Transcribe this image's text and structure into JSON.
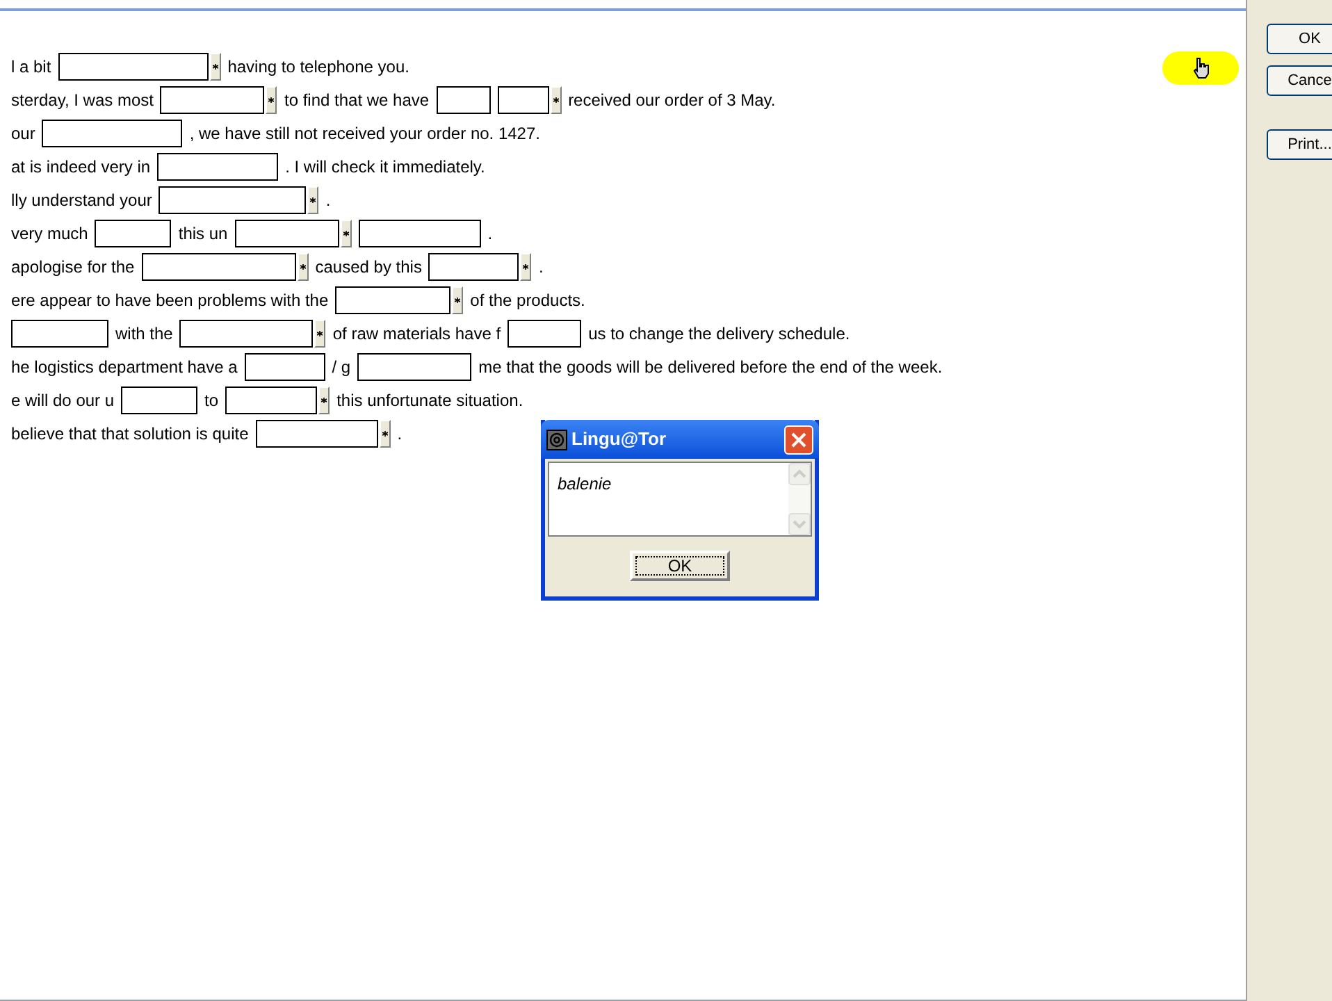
{
  "exercise": {
    "lines": [
      [
        {
          "kind": "text",
          "text": "l a bit"
        },
        {
          "kind": "blank_star"
        },
        {
          "kind": "text",
          "text": "having to telephone you."
        }
      ],
      [
        {
          "kind": "text",
          "text": "sterday, I was most"
        },
        {
          "kind": "blank_star"
        },
        {
          "kind": "text",
          "text": "to find that we have"
        },
        {
          "kind": "blank"
        },
        {
          "kind": "blank_star"
        },
        {
          "kind": "text",
          "text": "received our order of 3 May."
        }
      ],
      [
        {
          "kind": "text",
          "text": "our"
        },
        {
          "kind": "blank"
        },
        {
          "kind": "text",
          "text": ", we have still not received your order no. 1427."
        }
      ],
      [
        {
          "kind": "text",
          "text": "at is indeed very in"
        },
        {
          "kind": "blank"
        },
        {
          "kind": "text",
          "text": ". I will check it immediately."
        }
      ],
      [
        {
          "kind": "text",
          "text": "lly understand your"
        },
        {
          "kind": "blank_star"
        },
        {
          "kind": "text",
          "text": "."
        }
      ],
      [
        {
          "kind": "text",
          "text": "very much"
        },
        {
          "kind": "blank"
        },
        {
          "kind": "text",
          "text": "this un"
        },
        {
          "kind": "blank_star"
        },
        {
          "kind": "blank"
        },
        {
          "kind": "text",
          "text": "."
        }
      ],
      [
        {
          "kind": "text",
          "text": "apologise for the"
        },
        {
          "kind": "blank_star"
        },
        {
          "kind": "text",
          "text": "caused by this"
        },
        {
          "kind": "blank_star"
        },
        {
          "kind": "text",
          "text": "."
        }
      ],
      [
        {
          "kind": "text",
          "text": "ere appear to have been problems with the"
        },
        {
          "kind": "blank_star"
        },
        {
          "kind": "text",
          "text": "of the products."
        }
      ],
      [
        {
          "kind": "blank"
        },
        {
          "kind": "text",
          "text": "with the"
        },
        {
          "kind": "blank_star"
        },
        {
          "kind": "text",
          "text": "of raw materials have f"
        },
        {
          "kind": "blank"
        },
        {
          "kind": "text",
          "text": "us to change the delivery schedule."
        }
      ],
      [
        {
          "kind": "text",
          "text": "he logistics department have a"
        },
        {
          "kind": "blank"
        },
        {
          "kind": "text",
          "text": "/ g"
        },
        {
          "kind": "blank"
        },
        {
          "kind": "text",
          "text": "me that the goods will be delivered before the end of the week."
        }
      ],
      [
        {
          "kind": "text",
          "text": "e will do our u"
        },
        {
          "kind": "blank"
        },
        {
          "kind": "text",
          "text": "to"
        },
        {
          "kind": "blank_star"
        },
        {
          "kind": "text",
          "text": "this unfortunate situation."
        }
      ],
      [
        {
          "kind": "text",
          "text": "believe that that solution is quite"
        },
        {
          "kind": "blank_star"
        },
        {
          "kind": "text",
          "text": "."
        }
      ]
    ]
  },
  "side_buttons": [
    "OK",
    "Cance",
    "Print..."
  ],
  "dialog": {
    "title": "Lingu@Tor",
    "message": "balenie",
    "button": "OK"
  }
}
